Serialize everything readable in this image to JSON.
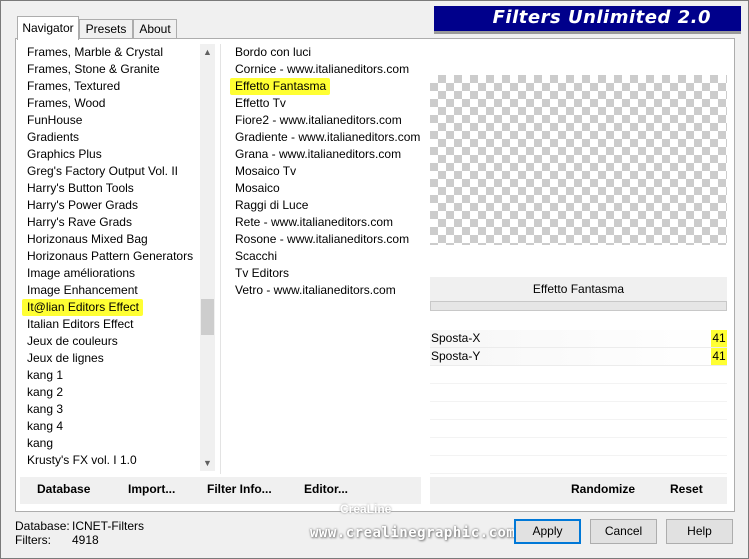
{
  "app": {
    "title": "Filters Unlimited 2.0"
  },
  "tabs": [
    {
      "label": "Navigator",
      "active": true
    },
    {
      "label": "Presets",
      "active": false
    },
    {
      "label": "About",
      "active": false
    }
  ],
  "categories": [
    "Frames, Marble & Crystal",
    "Frames, Stone & Granite",
    "Frames, Textured",
    "Frames, Wood",
    "FunHouse",
    "Gradients",
    "Graphics Plus",
    "Greg's Factory Output Vol. II",
    "Harry's Button Tools",
    "Harry's Power Grads",
    "Harry's Rave Grads",
    "Horizonaus Mixed Bag",
    "Horizonaus Pattern Generators",
    "Image améliorations",
    "Image Enhancement",
    "It@lian Editors Effect",
    "Italian Editors Effect",
    "Jeux de couleurs",
    "Jeux de lignes",
    "kang 1",
    "kang 2",
    "kang 3",
    "kang 4",
    "kang",
    "Krusty's FX vol. I 1.0"
  ],
  "selected_category_index": 15,
  "filters": [
    "Bordo con luci",
    "Cornice - www.italianeditors.com",
    "Effetto Fantasma",
    "Effetto Tv",
    "Fiore2 - www.italianeditors.com",
    "Gradiente - www.italianeditors.com",
    "Grana - www.italianeditors.com",
    "Mosaico Tv",
    "Mosaico",
    "Raggi di Luce",
    "Rete - www.italianeditors.com",
    "Rosone - www.italianeditors.com",
    "Scacchi",
    "Tv Editors",
    "Vetro - www.italianeditors.com"
  ],
  "selected_filter_index": 2,
  "selected_filter_name": "Effetto Fantasma",
  "params": [
    {
      "label": "Sposta-X",
      "value": "41"
    },
    {
      "label": "Sposta-Y",
      "value": "41"
    }
  ],
  "left_buttons": {
    "database": "Database",
    "import": "Import...",
    "filter_info": "Filter Info...",
    "editor": "Editor..."
  },
  "right_buttons": {
    "randomize": "Randomize",
    "reset": "Reset"
  },
  "info": {
    "database_label": "Database:",
    "database_value": "ICNET-Filters",
    "filters_label": "Filters:",
    "filters_value": "4918"
  },
  "watermark": {
    "line1": "CreaLine",
    "line2": "www.crealinegraphic.com"
  },
  "dialog_buttons": {
    "apply": "Apply",
    "cancel": "Cancel",
    "help": "Help"
  },
  "colors": {
    "banner_bg": "#00008b",
    "highlight": "#ffff33",
    "primary_border": "#0078d7"
  }
}
